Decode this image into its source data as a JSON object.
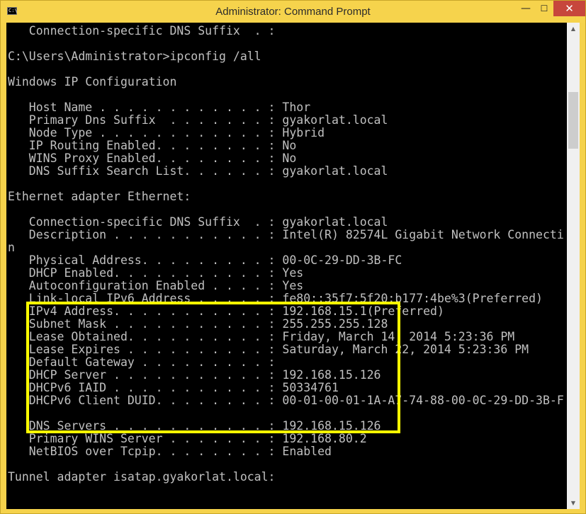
{
  "window": {
    "title": "Administrator: Command Prompt",
    "icon": "cmd-icon",
    "controls": {
      "minimize": "—",
      "maximize": "☐",
      "close": "✕"
    }
  },
  "console": {
    "lines": [
      "   Connection-specific DNS Suffix  . :",
      "",
      "C:\\Users\\Administrator>ipconfig /all",
      "",
      "Windows IP Configuration",
      "",
      "   Host Name . . . . . . . . . . . . : Thor",
      "   Primary Dns Suffix  . . . . . . . : gyakorlat.local",
      "   Node Type . . . . . . . . . . . . : Hybrid",
      "   IP Routing Enabled. . . . . . . . : No",
      "   WINS Proxy Enabled. . . . . . . . : No",
      "   DNS Suffix Search List. . . . . . : gyakorlat.local",
      "",
      "Ethernet adapter Ethernet:",
      "",
      "   Connection-specific DNS Suffix  . : gyakorlat.local",
      "   Description . . . . . . . . . . . : Intel(R) 82574L Gigabit Network Connecti",
      "n",
      "   Physical Address. . . . . . . . . : 00-0C-29-DD-3B-FC",
      "   DHCP Enabled. . . . . . . . . . . : Yes",
      "   Autoconfiguration Enabled . . . . : Yes",
      "   Link-local IPv6 Address . . . . . : fe80::35f7:5f20:b177:4be%3(Preferred)",
      "   IPv4 Address. . . . . . . . . . . : 192.168.15.1(Preferred)",
      "   Subnet Mask . . . . . . . . . . . : 255.255.255.128",
      "   Lease Obtained. . . . . . . . . . : Friday, March 14, 2014 5:23:36 PM",
      "   Lease Expires . . . . . . . . . . : Saturday, March 22, 2014 5:23:36 PM",
      "   Default Gateway . . . . . . . . . :",
      "   DHCP Server . . . . . . . . . . . : 192.168.15.126",
      "   DHCPv6 IAID . . . . . . . . . . . : 50334761",
      "   DHCPv6 Client DUID. . . . . . . . : 00-01-00-01-1A-A7-74-88-00-0C-29-DD-3B-F",
      "",
      "   DNS Servers . . . . . . . . . . . : 192.168.15.126",
      "   Primary WINS Server . . . . . . . : 192.168.80.2",
      "   NetBIOS over Tcpip. . . . . . . . : Enabled",
      "",
      "Tunnel adapter isatap.gyakorlat.local:"
    ]
  },
  "highlight": {
    "color": "#ffff00"
  },
  "scrollbar": {
    "up_arrow": "▲",
    "down_arrow": "▼"
  }
}
